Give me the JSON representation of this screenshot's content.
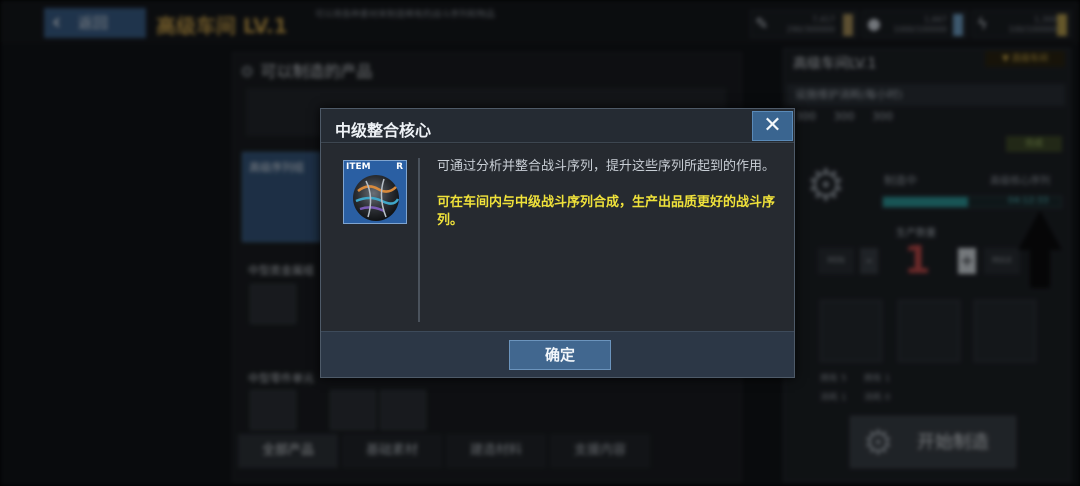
{
  "background": {
    "back_label": "返回",
    "back_icon": "chevron-left-icon",
    "workshop_title": "高级车间 LV.1",
    "workshop_desc": "可以用各种素材来制造稀有的战斗序列和物品",
    "resources": [
      {
        "icon": "metal-icon",
        "amount": "7,417\n290/300000",
        "bar_color": "#a9915a"
      },
      {
        "icon": "drop-icon",
        "amount": "1,667\n1000/100000",
        "bar_color": "#6fa0c7"
      },
      {
        "icon": "bolt-icon",
        "amount": "1,300\n100/100000",
        "bar_color": "#b9a04f"
      }
    ],
    "left_panel_title": "可以制造的产品",
    "selected_product": "高级序列组",
    "product_groups": [
      "中型类金属组",
      "中型零件单元"
    ],
    "tabs": [
      "全部产品",
      "基础素材",
      "建造材料",
      "支援内容"
    ],
    "right_panel_title": "高级车间LV.1",
    "right_tag": "▼ 高级车间",
    "maintenance_label": "设施维护消耗(每小时)",
    "maintenance_costs": [
      "300",
      "300",
      "300"
    ],
    "status": "完成",
    "making_label": "制造中",
    "making_item": "高级核心序列",
    "progress": 0.48,
    "progress_time": "04:12:33",
    "count_label": "生产数量",
    "qty_min": "MIN",
    "qty_minus": "-",
    "quantity": "1",
    "qty_plus": "+",
    "qty_max": "MAX",
    "material_stats": [
      "拥有 5",
      "消耗 1",
      "拥有 1",
      "消耗 0"
    ],
    "start_label": "开始制造"
  },
  "modal": {
    "title": "中级整合核心",
    "close_label": "✕",
    "item_tag": "ITEM",
    "item_rarity": "R",
    "item_icon": "core-orb-icon",
    "description": "可通过分析并整合战斗序列，提升这些序列所起到的作用。",
    "highlight": "可在车间内与中级战斗序列合成，生产出品质更好的战斗序列。",
    "confirm_label": "确定"
  },
  "colors": {
    "highlight_text": "#f0e23a",
    "accent_blue": "#41678f",
    "item_frame": "#2a5fa3"
  }
}
